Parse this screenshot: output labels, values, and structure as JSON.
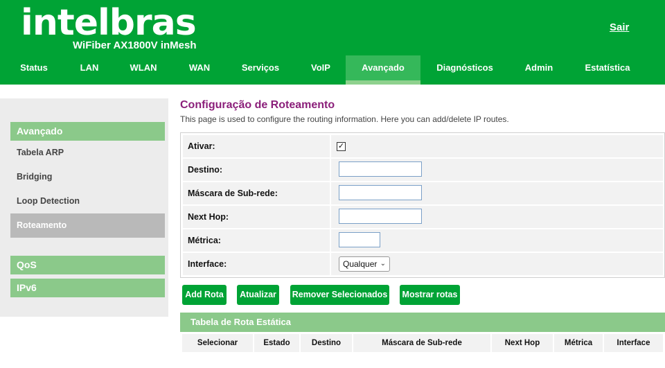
{
  "header": {
    "logo": "intelbras",
    "model": "WiFiber AX1800V inMesh",
    "logout": "Sair"
  },
  "nav": {
    "status": "Status",
    "lan": "LAN",
    "wlan": "WLAN",
    "wan": "WAN",
    "servicos": "Serviços",
    "voip": "VoIP",
    "avancado": "Avançado",
    "diagnosticos": "Diagnósticos",
    "admin": "Admin",
    "estatistica": "Estatística"
  },
  "sidebar": {
    "section_avancado": "Avançado",
    "tabela_arp": "Tabela ARP",
    "bridging": "Bridging",
    "loop_detection": "Loop Detection",
    "roteamento": "Roteamento",
    "section_qos": "QoS",
    "section_ipv6": "IPv6"
  },
  "page": {
    "title": "Configuração de Roteamento",
    "description": "This page is used to configure the routing information. Here you can add/delete IP routes."
  },
  "form": {
    "ativar_label": "Ativar:",
    "ativar_checked": "✓",
    "destino_label": "Destino:",
    "destino_value": "",
    "mascara_label": "Máscara de Sub-rede:",
    "mascara_value": "",
    "nexthop_label": "Next Hop:",
    "nexthop_value": "",
    "metrica_label": "Métrica:",
    "metrica_value": "",
    "interface_label": "Interface:",
    "interface_selected": "Qualquer"
  },
  "buttons": {
    "add": "Add Rota",
    "update": "Atualizar",
    "remove": "Remover Selecionados",
    "show": "Mostrar rotas"
  },
  "table": {
    "title": "Tabela de Rota Estática",
    "columns": {
      "selecionar": "Selecionar",
      "estado": "Estado",
      "destino": "Destino",
      "mascara": "Máscara de Sub-rede",
      "nexthop": "Next Hop",
      "metrica": "Métrica",
      "interface": "Interface"
    }
  },
  "colors": {
    "brand_green": "#00a335",
    "light_green": "#8bc98a",
    "title_purple": "#8b1f7a"
  }
}
